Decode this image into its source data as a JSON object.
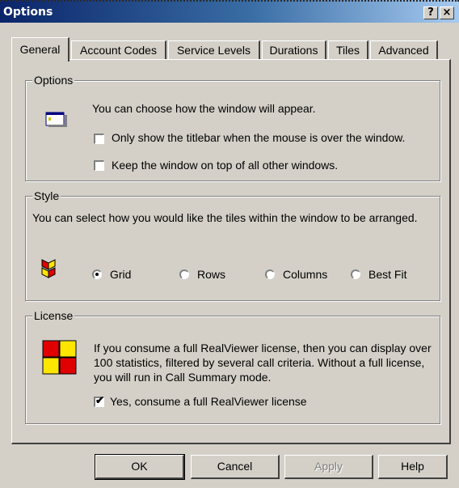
{
  "window": {
    "title": "Options"
  },
  "titlebar": {
    "help_label": "?",
    "close_label": "×"
  },
  "tabs": [
    {
      "label": "General",
      "active": true
    },
    {
      "label": "Account Codes"
    },
    {
      "label": "Service Levels"
    },
    {
      "label": "Durations"
    },
    {
      "label": "Tiles"
    },
    {
      "label": "Advanced"
    }
  ],
  "options_group": {
    "label": "Options",
    "description": "You can choose how the window will appear.",
    "checkbox1": {
      "label": "Only show the titlebar when the mouse is over the window.",
      "checked": false
    },
    "checkbox2": {
      "label": "Keep the window on top of all other windows.",
      "checked": false
    },
    "icon": "window-icon"
  },
  "style_group": {
    "label": "Style",
    "description": "You can select how you would like the tiles within the window to be arranged.",
    "icon": "tiles-icon",
    "radios": [
      {
        "label": "Grid",
        "selected": true
      },
      {
        "label": "Rows",
        "selected": false
      },
      {
        "label": "Columns",
        "selected": false
      },
      {
        "label": "Best Fit",
        "selected": false
      }
    ]
  },
  "license_group": {
    "label": "License",
    "description": "If you consume a full RealViewer license, then you can display over 100 statistics, filtered by several call criteria. Without a full license, you will run in Call Summary mode.",
    "icon": "license-grid-icon",
    "checkbox": {
      "label": "Yes, consume a full RealViewer license",
      "checked": true,
      "mark": "✔"
    }
  },
  "buttons": {
    "ok": "OK",
    "cancel": "Cancel",
    "apply": "Apply",
    "help": "Help"
  },
  "colors": {
    "titlebar_start": "#0a246a",
    "titlebar_end": "#a6caf0",
    "face": "#d4d0c8",
    "red": "#e00000",
    "yellow": "#ffe600"
  }
}
